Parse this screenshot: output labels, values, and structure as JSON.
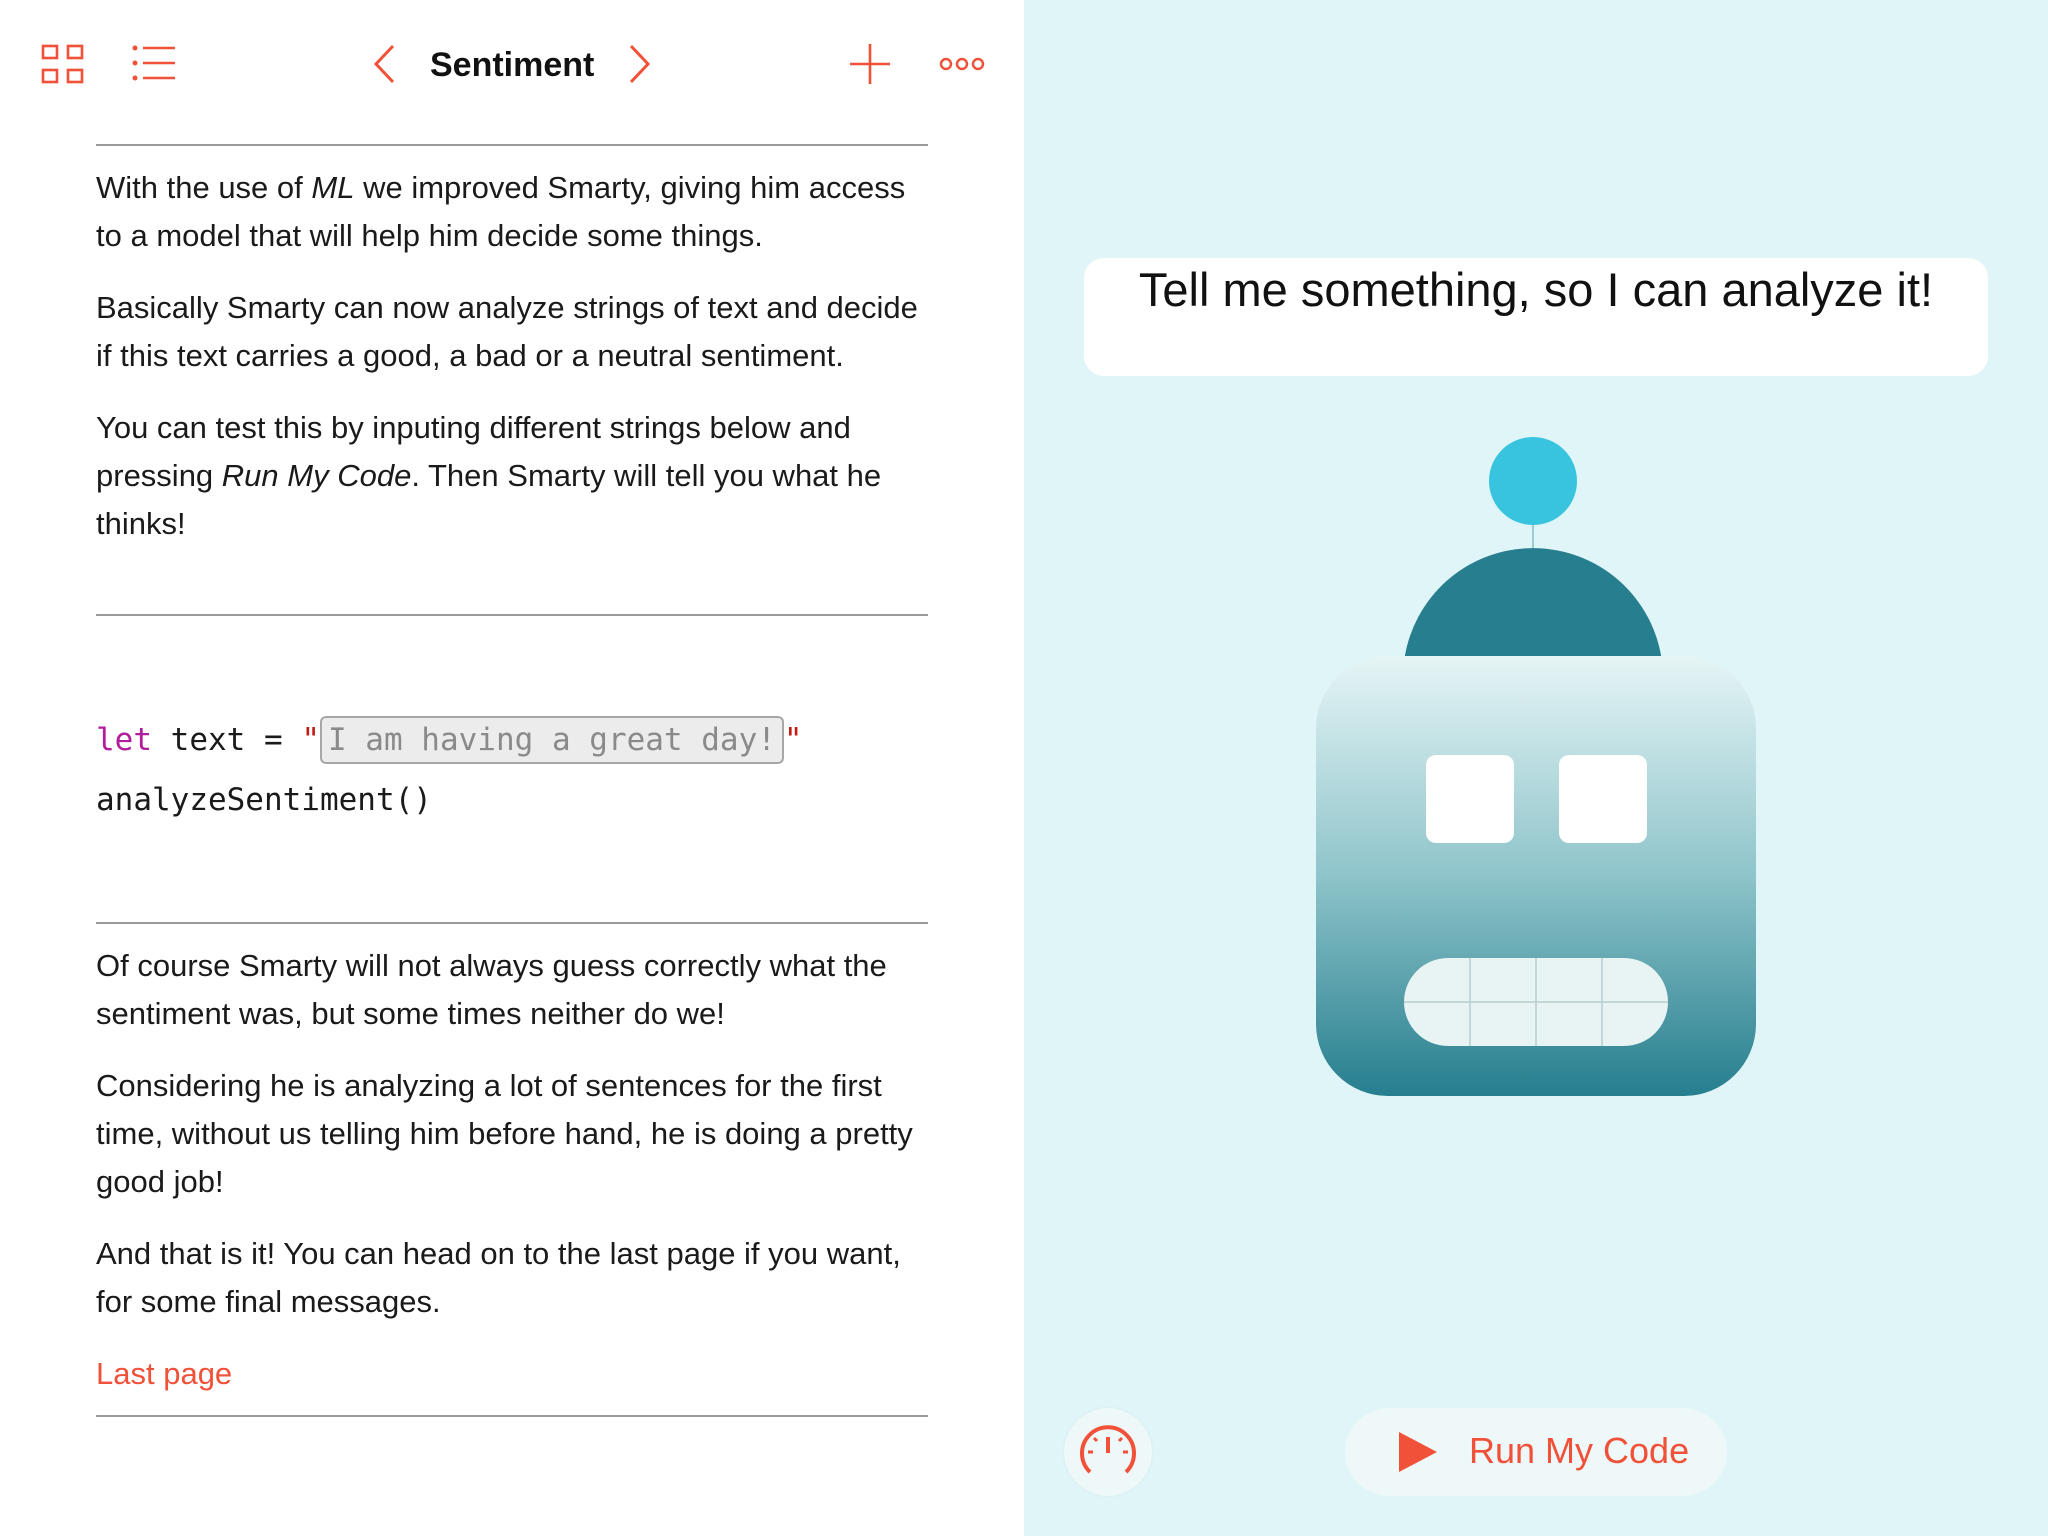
{
  "toolbar": {
    "title": "Sentiment",
    "icons": [
      "grid-icon",
      "list-icon",
      "chevron-left-icon",
      "chevron-right-icon",
      "plus-icon",
      "more-icon"
    ]
  },
  "content": {
    "intro": {
      "p1_a": "With the use of ",
      "p1_em": "ML",
      "p1_b": " we improved Smarty, giving him access to a model that will help him decide some things.",
      "p2": "Basically Smarty can now analyze strings of text and decide if this text carries a good, a bad or a neutral sentiment.",
      "p3_a": "You can test this by inputing different strings below and pressing ",
      "p3_em": "Run My Code",
      "p3_b": ". Then Smarty will tell you what he thinks!"
    },
    "code": {
      "keyword": "let",
      "text_decl": " text = ",
      "quote_open": "\"",
      "editable_value": "I am having a great day!",
      "quote_close": "\"",
      "line2": "analyzeSentiment()"
    },
    "outro": {
      "p1": "Of course Smarty will not always guess correctly what the sentiment was, but some times neither do we!",
      "p2": "Considering he is analyzing a lot of sentences for the first time, without us telling him before hand, he is doing a pretty good job!",
      "p3": "And that is it! You can head on to the last page if you want, for some final messages."
    },
    "link": "Last page"
  },
  "live_view": {
    "speech": "Tell me something, so I can analyze it!",
    "run_button": "Run My Code",
    "speed_icon": "speedometer-icon"
  },
  "colors": {
    "accent": "#f05138",
    "live_bg": "#dff5f7",
    "robot_teal": "#267e8e",
    "antenna": "#38c4de",
    "keyword": "#b21d9c",
    "string": "#c41a16"
  }
}
